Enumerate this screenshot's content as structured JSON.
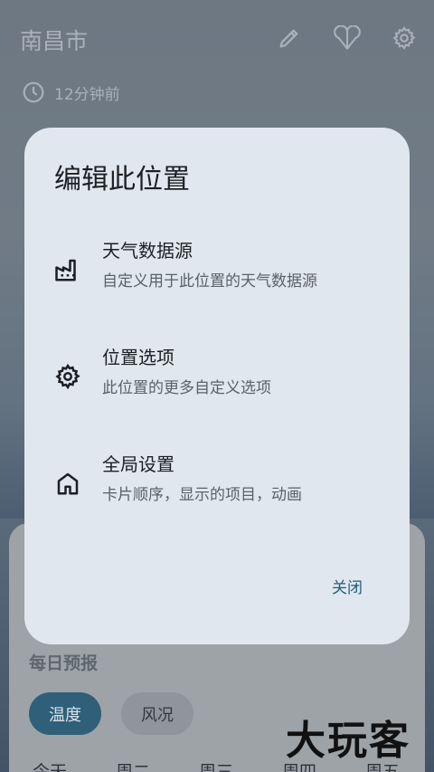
{
  "header": {
    "city": "南昌市",
    "updated": "12分钟前",
    "icons": [
      "edit-icon",
      "location-icon",
      "settings-icon"
    ]
  },
  "dialog": {
    "title": "编辑此位置",
    "options": [
      {
        "icon": "factory-icon",
        "title": "天气数据源",
        "subtitle": "自定义用于此位置的天气数据源"
      },
      {
        "icon": "gear-icon",
        "title": "位置选项",
        "subtitle": "此位置的更多自定义选项"
      },
      {
        "icon": "home-icon",
        "title": "全局设置",
        "subtitle": "卡片顺序，显示的项目，动画"
      }
    ],
    "close_label": "关闭"
  },
  "forecast": {
    "title": "每日预报",
    "chips": [
      "温度",
      "风况"
    ],
    "days": [
      "今天",
      "周二",
      "周三",
      "周四",
      "周五"
    ]
  },
  "watermark": "大玩客",
  "colors": {
    "dialog_bg": "#e1e7ee",
    "accent": "#1f5e7a",
    "chip_active": "#2f5f79"
  }
}
